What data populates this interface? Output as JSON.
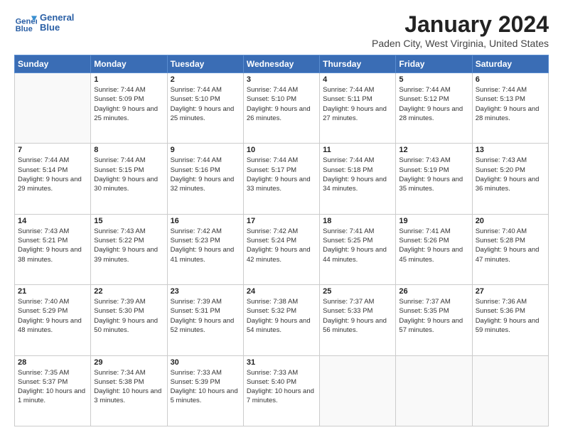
{
  "header": {
    "logo_line1": "General",
    "logo_line2": "Blue",
    "month_title": "January 2024",
    "location": "Paden City, West Virginia, United States"
  },
  "weekdays": [
    "Sunday",
    "Monday",
    "Tuesday",
    "Wednesday",
    "Thursday",
    "Friday",
    "Saturday"
  ],
  "weeks": [
    [
      {
        "day": "",
        "sunrise": "",
        "sunset": "",
        "daylight": ""
      },
      {
        "day": "1",
        "sunrise": "Sunrise: 7:44 AM",
        "sunset": "Sunset: 5:09 PM",
        "daylight": "Daylight: 9 hours and 25 minutes."
      },
      {
        "day": "2",
        "sunrise": "Sunrise: 7:44 AM",
        "sunset": "Sunset: 5:10 PM",
        "daylight": "Daylight: 9 hours and 25 minutes."
      },
      {
        "day": "3",
        "sunrise": "Sunrise: 7:44 AM",
        "sunset": "Sunset: 5:10 PM",
        "daylight": "Daylight: 9 hours and 26 minutes."
      },
      {
        "day": "4",
        "sunrise": "Sunrise: 7:44 AM",
        "sunset": "Sunset: 5:11 PM",
        "daylight": "Daylight: 9 hours and 27 minutes."
      },
      {
        "day": "5",
        "sunrise": "Sunrise: 7:44 AM",
        "sunset": "Sunset: 5:12 PM",
        "daylight": "Daylight: 9 hours and 28 minutes."
      },
      {
        "day": "6",
        "sunrise": "Sunrise: 7:44 AM",
        "sunset": "Sunset: 5:13 PM",
        "daylight": "Daylight: 9 hours and 28 minutes."
      }
    ],
    [
      {
        "day": "7",
        "sunrise": "Sunrise: 7:44 AM",
        "sunset": "Sunset: 5:14 PM",
        "daylight": "Daylight: 9 hours and 29 minutes."
      },
      {
        "day": "8",
        "sunrise": "Sunrise: 7:44 AM",
        "sunset": "Sunset: 5:15 PM",
        "daylight": "Daylight: 9 hours and 30 minutes."
      },
      {
        "day": "9",
        "sunrise": "Sunrise: 7:44 AM",
        "sunset": "Sunset: 5:16 PM",
        "daylight": "Daylight: 9 hours and 32 minutes."
      },
      {
        "day": "10",
        "sunrise": "Sunrise: 7:44 AM",
        "sunset": "Sunset: 5:17 PM",
        "daylight": "Daylight: 9 hours and 33 minutes."
      },
      {
        "day": "11",
        "sunrise": "Sunrise: 7:44 AM",
        "sunset": "Sunset: 5:18 PM",
        "daylight": "Daylight: 9 hours and 34 minutes."
      },
      {
        "day": "12",
        "sunrise": "Sunrise: 7:43 AM",
        "sunset": "Sunset: 5:19 PM",
        "daylight": "Daylight: 9 hours and 35 minutes."
      },
      {
        "day": "13",
        "sunrise": "Sunrise: 7:43 AM",
        "sunset": "Sunset: 5:20 PM",
        "daylight": "Daylight: 9 hours and 36 minutes."
      }
    ],
    [
      {
        "day": "14",
        "sunrise": "Sunrise: 7:43 AM",
        "sunset": "Sunset: 5:21 PM",
        "daylight": "Daylight: 9 hours and 38 minutes."
      },
      {
        "day": "15",
        "sunrise": "Sunrise: 7:43 AM",
        "sunset": "Sunset: 5:22 PM",
        "daylight": "Daylight: 9 hours and 39 minutes."
      },
      {
        "day": "16",
        "sunrise": "Sunrise: 7:42 AM",
        "sunset": "Sunset: 5:23 PM",
        "daylight": "Daylight: 9 hours and 41 minutes."
      },
      {
        "day": "17",
        "sunrise": "Sunrise: 7:42 AM",
        "sunset": "Sunset: 5:24 PM",
        "daylight": "Daylight: 9 hours and 42 minutes."
      },
      {
        "day": "18",
        "sunrise": "Sunrise: 7:41 AM",
        "sunset": "Sunset: 5:25 PM",
        "daylight": "Daylight: 9 hours and 44 minutes."
      },
      {
        "day": "19",
        "sunrise": "Sunrise: 7:41 AM",
        "sunset": "Sunset: 5:26 PM",
        "daylight": "Daylight: 9 hours and 45 minutes."
      },
      {
        "day": "20",
        "sunrise": "Sunrise: 7:40 AM",
        "sunset": "Sunset: 5:28 PM",
        "daylight": "Daylight: 9 hours and 47 minutes."
      }
    ],
    [
      {
        "day": "21",
        "sunrise": "Sunrise: 7:40 AM",
        "sunset": "Sunset: 5:29 PM",
        "daylight": "Daylight: 9 hours and 48 minutes."
      },
      {
        "day": "22",
        "sunrise": "Sunrise: 7:39 AM",
        "sunset": "Sunset: 5:30 PM",
        "daylight": "Daylight: 9 hours and 50 minutes."
      },
      {
        "day": "23",
        "sunrise": "Sunrise: 7:39 AM",
        "sunset": "Sunset: 5:31 PM",
        "daylight": "Daylight: 9 hours and 52 minutes."
      },
      {
        "day": "24",
        "sunrise": "Sunrise: 7:38 AM",
        "sunset": "Sunset: 5:32 PM",
        "daylight": "Daylight: 9 hours and 54 minutes."
      },
      {
        "day": "25",
        "sunrise": "Sunrise: 7:37 AM",
        "sunset": "Sunset: 5:33 PM",
        "daylight": "Daylight: 9 hours and 56 minutes."
      },
      {
        "day": "26",
        "sunrise": "Sunrise: 7:37 AM",
        "sunset": "Sunset: 5:35 PM",
        "daylight": "Daylight: 9 hours and 57 minutes."
      },
      {
        "day": "27",
        "sunrise": "Sunrise: 7:36 AM",
        "sunset": "Sunset: 5:36 PM",
        "daylight": "Daylight: 9 hours and 59 minutes."
      }
    ],
    [
      {
        "day": "28",
        "sunrise": "Sunrise: 7:35 AM",
        "sunset": "Sunset: 5:37 PM",
        "daylight": "Daylight: 10 hours and 1 minute."
      },
      {
        "day": "29",
        "sunrise": "Sunrise: 7:34 AM",
        "sunset": "Sunset: 5:38 PM",
        "daylight": "Daylight: 10 hours and 3 minutes."
      },
      {
        "day": "30",
        "sunrise": "Sunrise: 7:33 AM",
        "sunset": "Sunset: 5:39 PM",
        "daylight": "Daylight: 10 hours and 5 minutes."
      },
      {
        "day": "31",
        "sunrise": "Sunrise: 7:33 AM",
        "sunset": "Sunset: 5:40 PM",
        "daylight": "Daylight: 10 hours and 7 minutes."
      },
      {
        "day": "",
        "sunrise": "",
        "sunset": "",
        "daylight": ""
      },
      {
        "day": "",
        "sunrise": "",
        "sunset": "",
        "daylight": ""
      },
      {
        "day": "",
        "sunrise": "",
        "sunset": "",
        "daylight": ""
      }
    ]
  ]
}
